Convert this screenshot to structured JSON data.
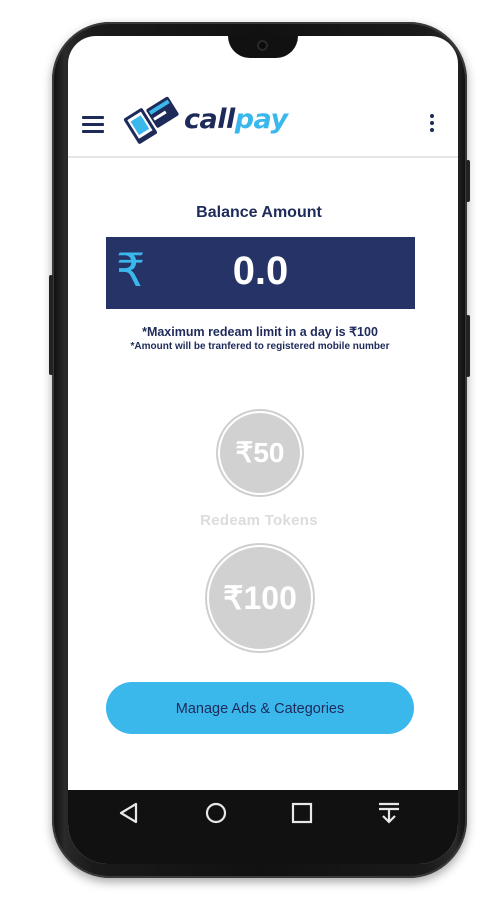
{
  "app": {
    "brand_part1": "call",
    "brand_part2": "pay",
    "brand_color_dark": "#1e2a5a",
    "brand_color_accent": "#3ab8ec"
  },
  "appbar": {
    "menu_icon": "hamburger-menu-icon",
    "overflow_icon": "more-vertical-icon"
  },
  "balance": {
    "title": "Balance Amount",
    "currency_symbol": "₹",
    "value": "0.0"
  },
  "notes": {
    "limit": "*Maximum redeam limit in a day is ₹100",
    "transfer": "*Amount will be tranfered to registered mobile number"
  },
  "tokens": {
    "small": "₹50",
    "label": "Redeam Tokens",
    "large": "₹100"
  },
  "actions": {
    "manage_label": "Manage Ads & Categories"
  },
  "navbar": {
    "back_icon": "back-triangle-icon",
    "home_icon": "home-circle-icon",
    "recents_icon": "recents-square-icon",
    "notifications_icon": "pull-down-notifications-icon"
  }
}
